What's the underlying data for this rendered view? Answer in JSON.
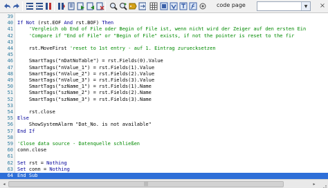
{
  "toolbar": {
    "buttons": [
      {
        "name": "undo-icon",
        "color": "#3a5fa8"
      },
      {
        "name": "redo-icon",
        "color": "#3a5fa8"
      },
      {
        "name": "indent-icon",
        "color": "#2c4f8c"
      },
      {
        "name": "outdent-icon",
        "color": "#2c4f8c"
      },
      {
        "name": "comment-icon",
        "color": "#c03030"
      },
      {
        "name": "uncomment-icon",
        "color": "#c03030"
      },
      {
        "name": "bookmark-toggle-icon",
        "color": "#2c4f8c"
      },
      {
        "name": "bookmark-next-icon",
        "color": "#2c4f8c"
      },
      {
        "name": "bookmark-prev-icon",
        "color": "#2c4f8c"
      },
      {
        "name": "bookmark-clear-icon",
        "color": "#2c4f8c"
      },
      {
        "name": "find-icon",
        "color": "#333333"
      },
      {
        "name": "find-next-icon",
        "color": "#333333"
      },
      {
        "name": "replace-icon",
        "color": "#d4a017"
      },
      {
        "name": "goto-icon",
        "color": "#2c4f8c"
      },
      {
        "name": "grid-icon",
        "color": "#555555"
      },
      {
        "name": "object-browser-icon",
        "color": "#3a5fa8"
      },
      {
        "name": "variable-icon",
        "color": "#3a5fa8"
      },
      {
        "name": "tag-icon",
        "color": "#3a5fa8"
      },
      {
        "name": "function-icon",
        "color": "#3a5fa8"
      },
      {
        "name": "settings-icon",
        "color": "#555555"
      }
    ],
    "code_page_label": "code page",
    "code_page_value": "",
    "close_symbol": "×"
  },
  "editor": {
    "lines": [
      {
        "num": "39",
        "code": "",
        "type": "plain"
      },
      {
        "num": "40",
        "code": "If Not (rst.EOF And rst.BOF) Then",
        "type": "kw-line"
      },
      {
        "num": "41",
        "code": "    'Vergleich ob End of File oder Begin of File ist, wenn nicht wird der Zeiger auf den ersten Ein",
        "type": "comment"
      },
      {
        "num": "42",
        "code": "    'Compare if \"End of File\" or \"Begin of File\" exists, if not the pointer is reset to the fir",
        "type": "comment"
      },
      {
        "num": "43",
        "code": "",
        "type": "plain"
      },
      {
        "num": "44",
        "code": "    rst.MoveFirst 'reset to 1st entry - auf 1. Eintrag zuruecksetzen",
        "type": "mixed"
      },
      {
        "num": "45",
        "code": "",
        "type": "plain"
      },
      {
        "num": "46",
        "code": "    SmartTags(\"nDatNoTable\") = rst.Fields(0).Value",
        "type": "plain"
      },
      {
        "num": "47",
        "code": "    SmartTags(\"nValue_1\") = rst.Fields(1).Value",
        "type": "plain"
      },
      {
        "num": "48",
        "code": "    SmartTags(\"nValue_2\") = rst.Fields(2).Value",
        "type": "plain"
      },
      {
        "num": "49",
        "code": "    SmartTags(\"nValue_3\") = rst.Fields(3).Value",
        "type": "plain"
      },
      {
        "num": "50",
        "code": "    SmartTags(\"szName_1\") = rst.Fields(1).Name",
        "type": "plain"
      },
      {
        "num": "51",
        "code": "    SmartTags(\"szName_2\") = rst.Fields(2).Name",
        "type": "plain"
      },
      {
        "num": "52",
        "code": "    SmartTags(\"szName_3\") = rst.Fields(3).Name",
        "type": "plain"
      },
      {
        "num": "53",
        "code": "",
        "type": "plain"
      },
      {
        "num": "54",
        "code": "    rst.close",
        "type": "plain"
      },
      {
        "num": "55",
        "code": "Else",
        "type": "kw"
      },
      {
        "num": "56",
        "code": "    ShowSystemAlarm \"Dat_No. is not available\"",
        "type": "plain"
      },
      {
        "num": "57",
        "code": "End If",
        "type": "kw"
      },
      {
        "num": "58",
        "code": "",
        "type": "plain"
      },
      {
        "num": "59",
        "code": "'Close data source - Datenquelle schließen",
        "type": "comment"
      },
      {
        "num": "60",
        "code": "conn.close",
        "type": "plain"
      },
      {
        "num": "61",
        "code": "",
        "type": "plain"
      },
      {
        "num": "62",
        "code": "Set rst = Nothing",
        "type": "set"
      },
      {
        "num": "63",
        "code": "Set conn = Nothing",
        "type": "set"
      },
      {
        "num": "64",
        "code": "End Sub",
        "type": "selected"
      }
    ]
  },
  "scrollbar": {
    "left_arrow": "◂",
    "right_arrow": "▸",
    "thumb_grip": "|||"
  }
}
